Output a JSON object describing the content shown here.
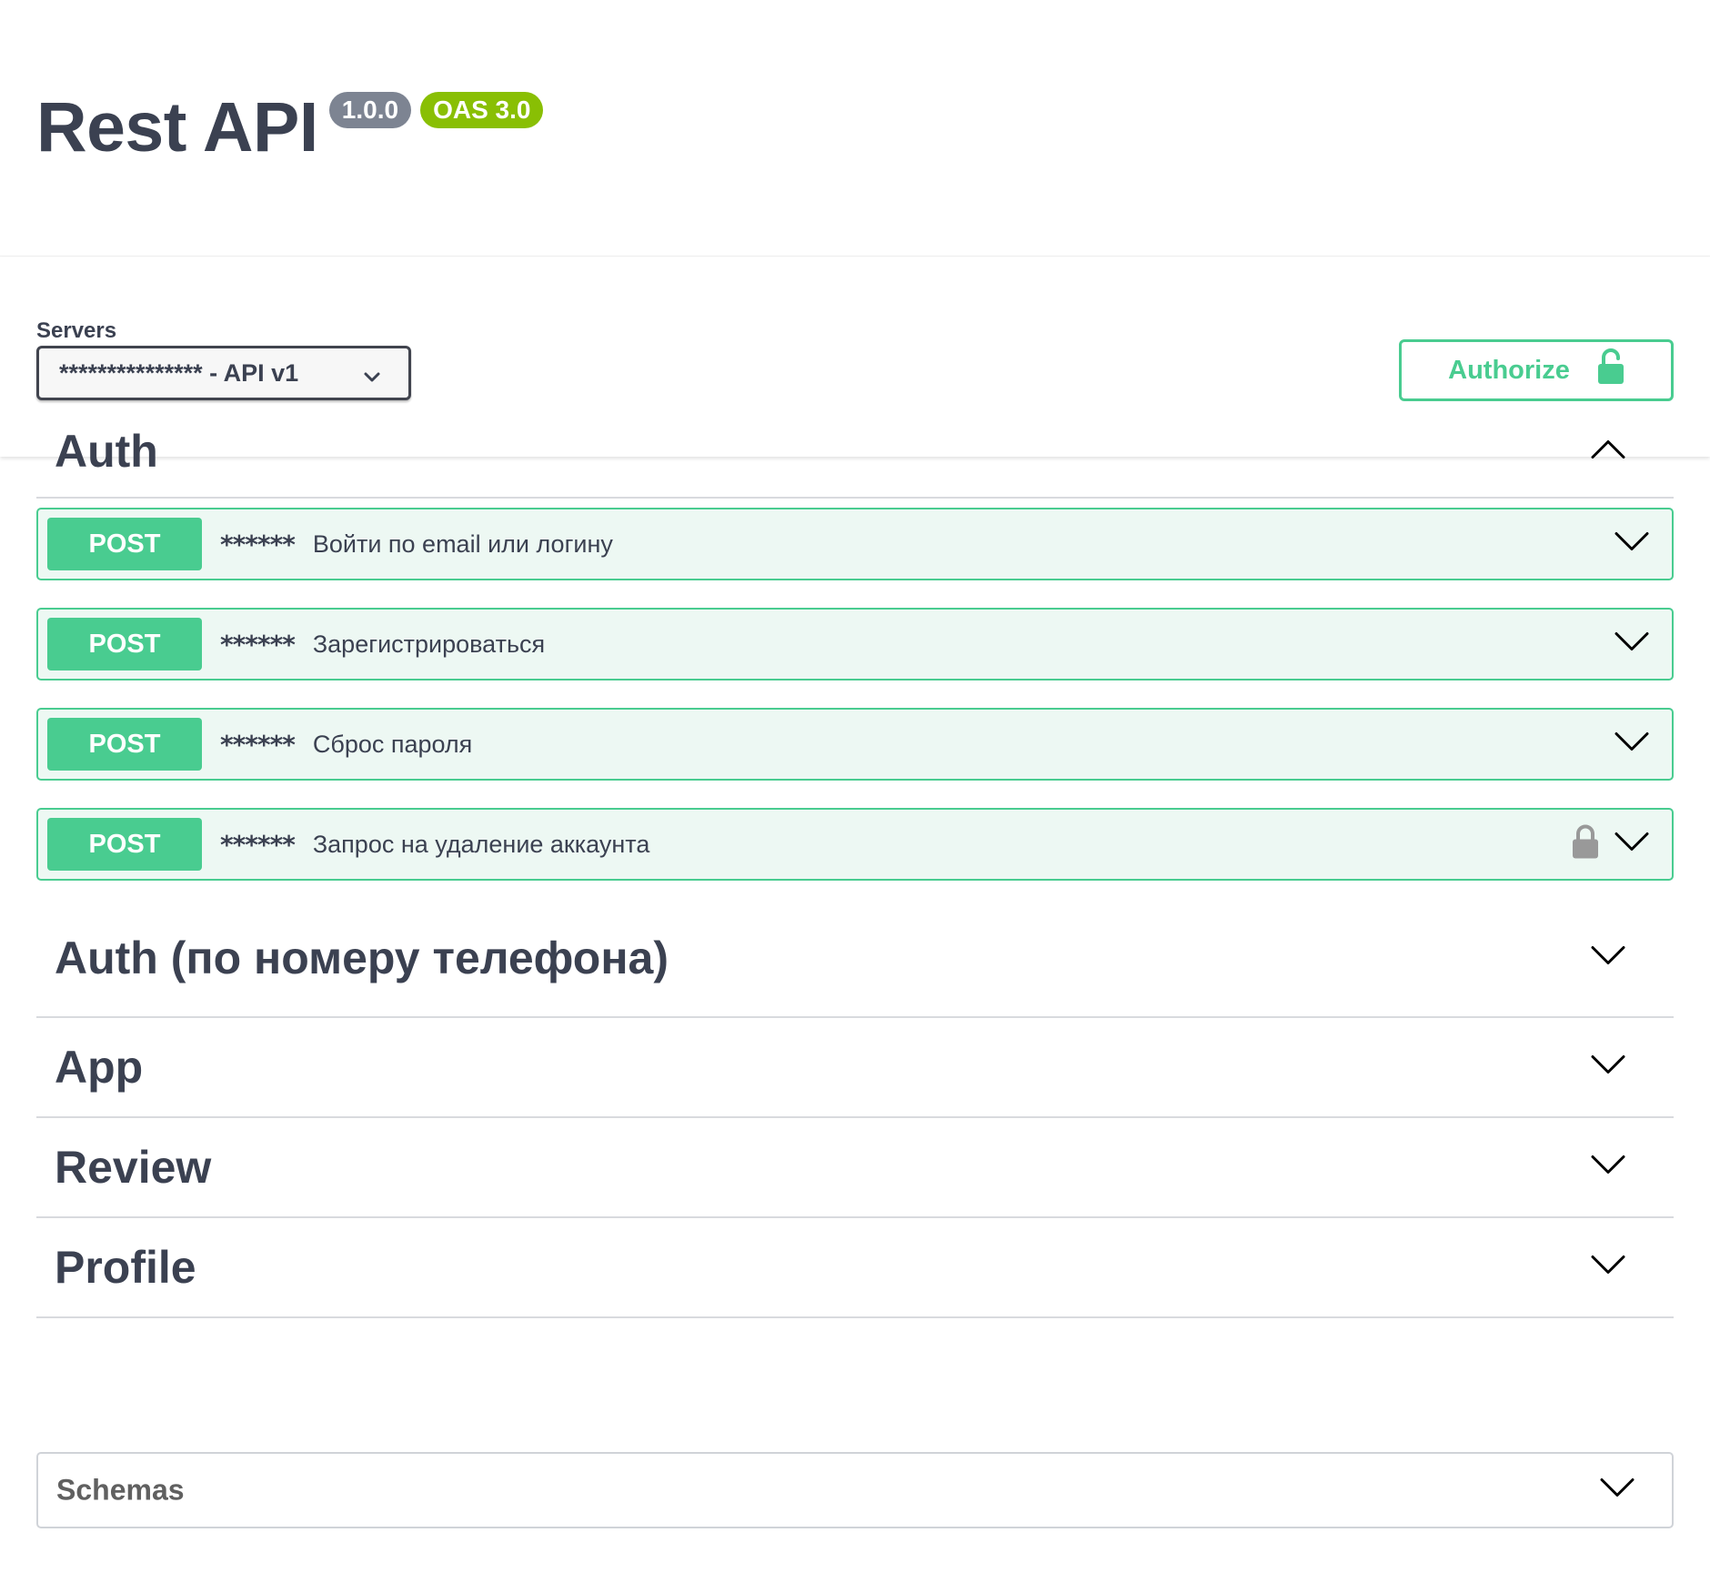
{
  "info": {
    "title": "Rest API",
    "version": "1.0.0",
    "oas_version": "OAS 3.0"
  },
  "servers": {
    "label": "Servers",
    "selected": "*************** - API v1"
  },
  "authorize": {
    "label": "Authorize"
  },
  "tags": [
    {
      "name": "Auth",
      "expanded": true,
      "operations": [
        {
          "method": "POST",
          "path": "******",
          "summary": "Войти по email или логину",
          "locked": false
        },
        {
          "method": "POST",
          "path": "******",
          "summary": "Зарегистрироваться",
          "locked": false
        },
        {
          "method": "POST",
          "path": "******",
          "summary": "Сброс пароля",
          "locked": false
        },
        {
          "method": "POST",
          "path": "******",
          "summary": "Запрос на удаление аккаунта",
          "locked": true
        }
      ]
    },
    {
      "name": "Auth (по номеру телефона)",
      "expanded": false
    },
    {
      "name": "App",
      "expanded": false
    },
    {
      "name": "Review",
      "expanded": false
    },
    {
      "name": "Profile",
      "expanded": false
    }
  ],
  "schemas": {
    "title": "Schemas"
  },
  "colors": {
    "post": "#49cc90",
    "post_bg": "#edf8f3",
    "version_badge": "#7d8492",
    "oas_badge": "#89bf04",
    "text": "#3b4151"
  },
  "icons": {
    "select": "chevron-down-icon",
    "authorize": "unlocked-padlock-icon",
    "tag_expanded": "chevron-up-icon",
    "tag_collapsed": "chevron-down-icon",
    "operation": "chevron-down-icon",
    "operation_locked": "padlock-icon"
  }
}
